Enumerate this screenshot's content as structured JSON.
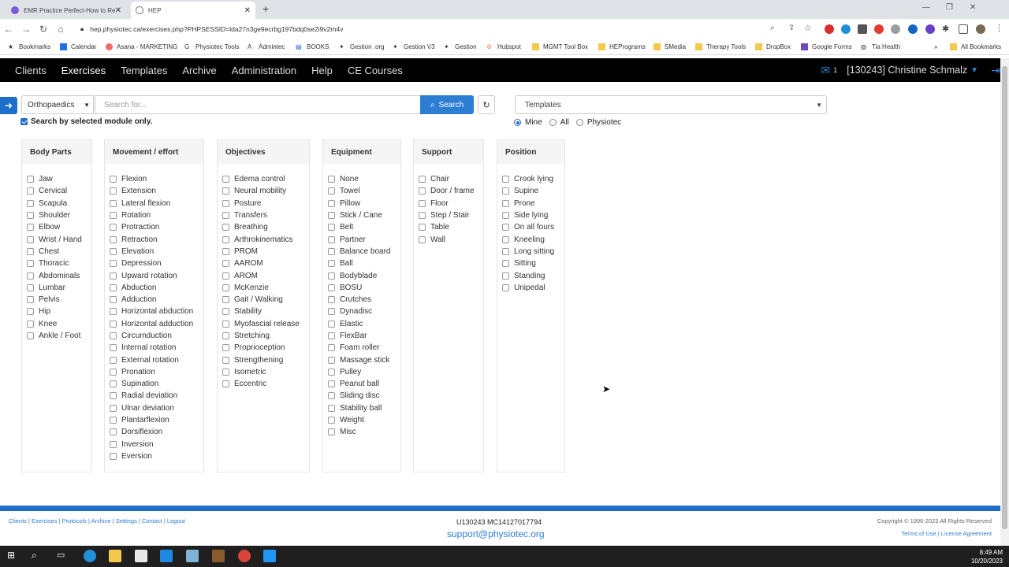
{
  "browser": {
    "tabs": [
      {
        "title": "EMR Practice Perfect-How to Re"
      },
      {
        "title": "HEP"
      }
    ],
    "url": "hep.physiotec.ca/exercises.php?PHPSESSID=lda27n3ge9ecrbg197bdq0se2i9v2m4v",
    "bookmarks": [
      "Bookmarks",
      "Calendar",
      "Asana - MARKETING",
      "Physiotec Tools",
      "Admintec",
      "BOOKS",
      "Gestion .org",
      "Gestion V3",
      "Gestion",
      "Hubspot",
      "MGMT Tool Box",
      "HEPrograms",
      "SMedia",
      "Therapy Tools",
      "DropBox",
      "Google Forms",
      "Tia Health",
      "All Bookmarks"
    ]
  },
  "nav": {
    "items": [
      "Clients",
      "Exercises",
      "Templates",
      "Archive",
      "Administration",
      "Help",
      "CE Courses"
    ],
    "active": "Exercises",
    "mail_count": "1",
    "user": "[130243] Christine Schmalz"
  },
  "search": {
    "module": "Orthopaedics",
    "placeholder": "Search for...",
    "button": "Search",
    "only_module_label": "Search by selected module only.",
    "templates_select": "Templates",
    "radios": [
      "Mine",
      "All",
      "Physiotec"
    ]
  },
  "columns": [
    {
      "title": "Body Parts",
      "items": [
        "Jaw",
        "Cervical",
        "Scapula",
        "Shoulder",
        "Elbow",
        "Wrist / Hand",
        "Chest",
        "Thoracic",
        "Abdominals",
        "Lumbar",
        "Pelvis",
        "Hip",
        "Knee",
        "Ankle / Foot"
      ]
    },
    {
      "title": "Movement / effort",
      "items": [
        "Flexion",
        "Extension",
        "Lateral flexion",
        "Rotation",
        "Protraction",
        "Retraction",
        "Elevation",
        "Depression",
        "Upward rotation",
        "Abduction",
        "Adduction",
        "Horizontal abduction",
        "Horizontal adduction",
        "Circumduction",
        "Internal rotation",
        "External rotation",
        "Pronation",
        "Supination",
        "Radial deviation",
        "Ulnar deviation",
        "Plantarflexion",
        "Dorsiflexion",
        "Inversion",
        "Eversion"
      ]
    },
    {
      "title": "Objectives",
      "items": [
        "Edema control",
        "Neural mobility",
        "Posture",
        "Transfers",
        "Breathing",
        "Arthrokinematics",
        "PROM",
        "AAROM",
        "AROM",
        "McKenzie",
        "Gait / Walking",
        "Stability",
        "Myofascial release",
        "Stretching",
        "Proprioception",
        "Strengthening",
        "Isometric",
        "Eccentric"
      ]
    },
    {
      "title": "Equipment",
      "items": [
        "None",
        "Towel",
        "Pillow",
        "Stick / Cane",
        "Belt",
        "Partner",
        "Balance board",
        "Ball",
        "Bodyblade",
        "BOSU",
        "Crutches",
        "Dynadisc",
        "Elastic",
        "FlexBar",
        "Foam roller",
        "Massage stick",
        "Pulley",
        "Peanut ball",
        "Sliding disc",
        "Stability ball",
        "Weight",
        "Misc"
      ]
    },
    {
      "title": "Support",
      "items": [
        "Chair",
        "Door / frame",
        "Floor",
        "Step / Stair",
        "Table",
        "Wall"
      ]
    },
    {
      "title": "Position",
      "items": [
        "Crook lying",
        "Supine",
        "Prone",
        "Side lying",
        "On all fours",
        "Kneeling",
        "Long sitting",
        "Sitting",
        "Standing",
        "Unipedal"
      ]
    }
  ],
  "footer": {
    "links": "Clients | Exercises | Protocols | Archive | Settings | Contact | Logout",
    "ids": "U130243 MC14127017794",
    "email": "support@physiotec.org",
    "copyright": "Copyright © 1996-2023 All Rights Reserved",
    "terms": "Terms of Use | License Agreement"
  },
  "clock": {
    "time": "8:49 AM",
    "date": "10/20/2023"
  }
}
